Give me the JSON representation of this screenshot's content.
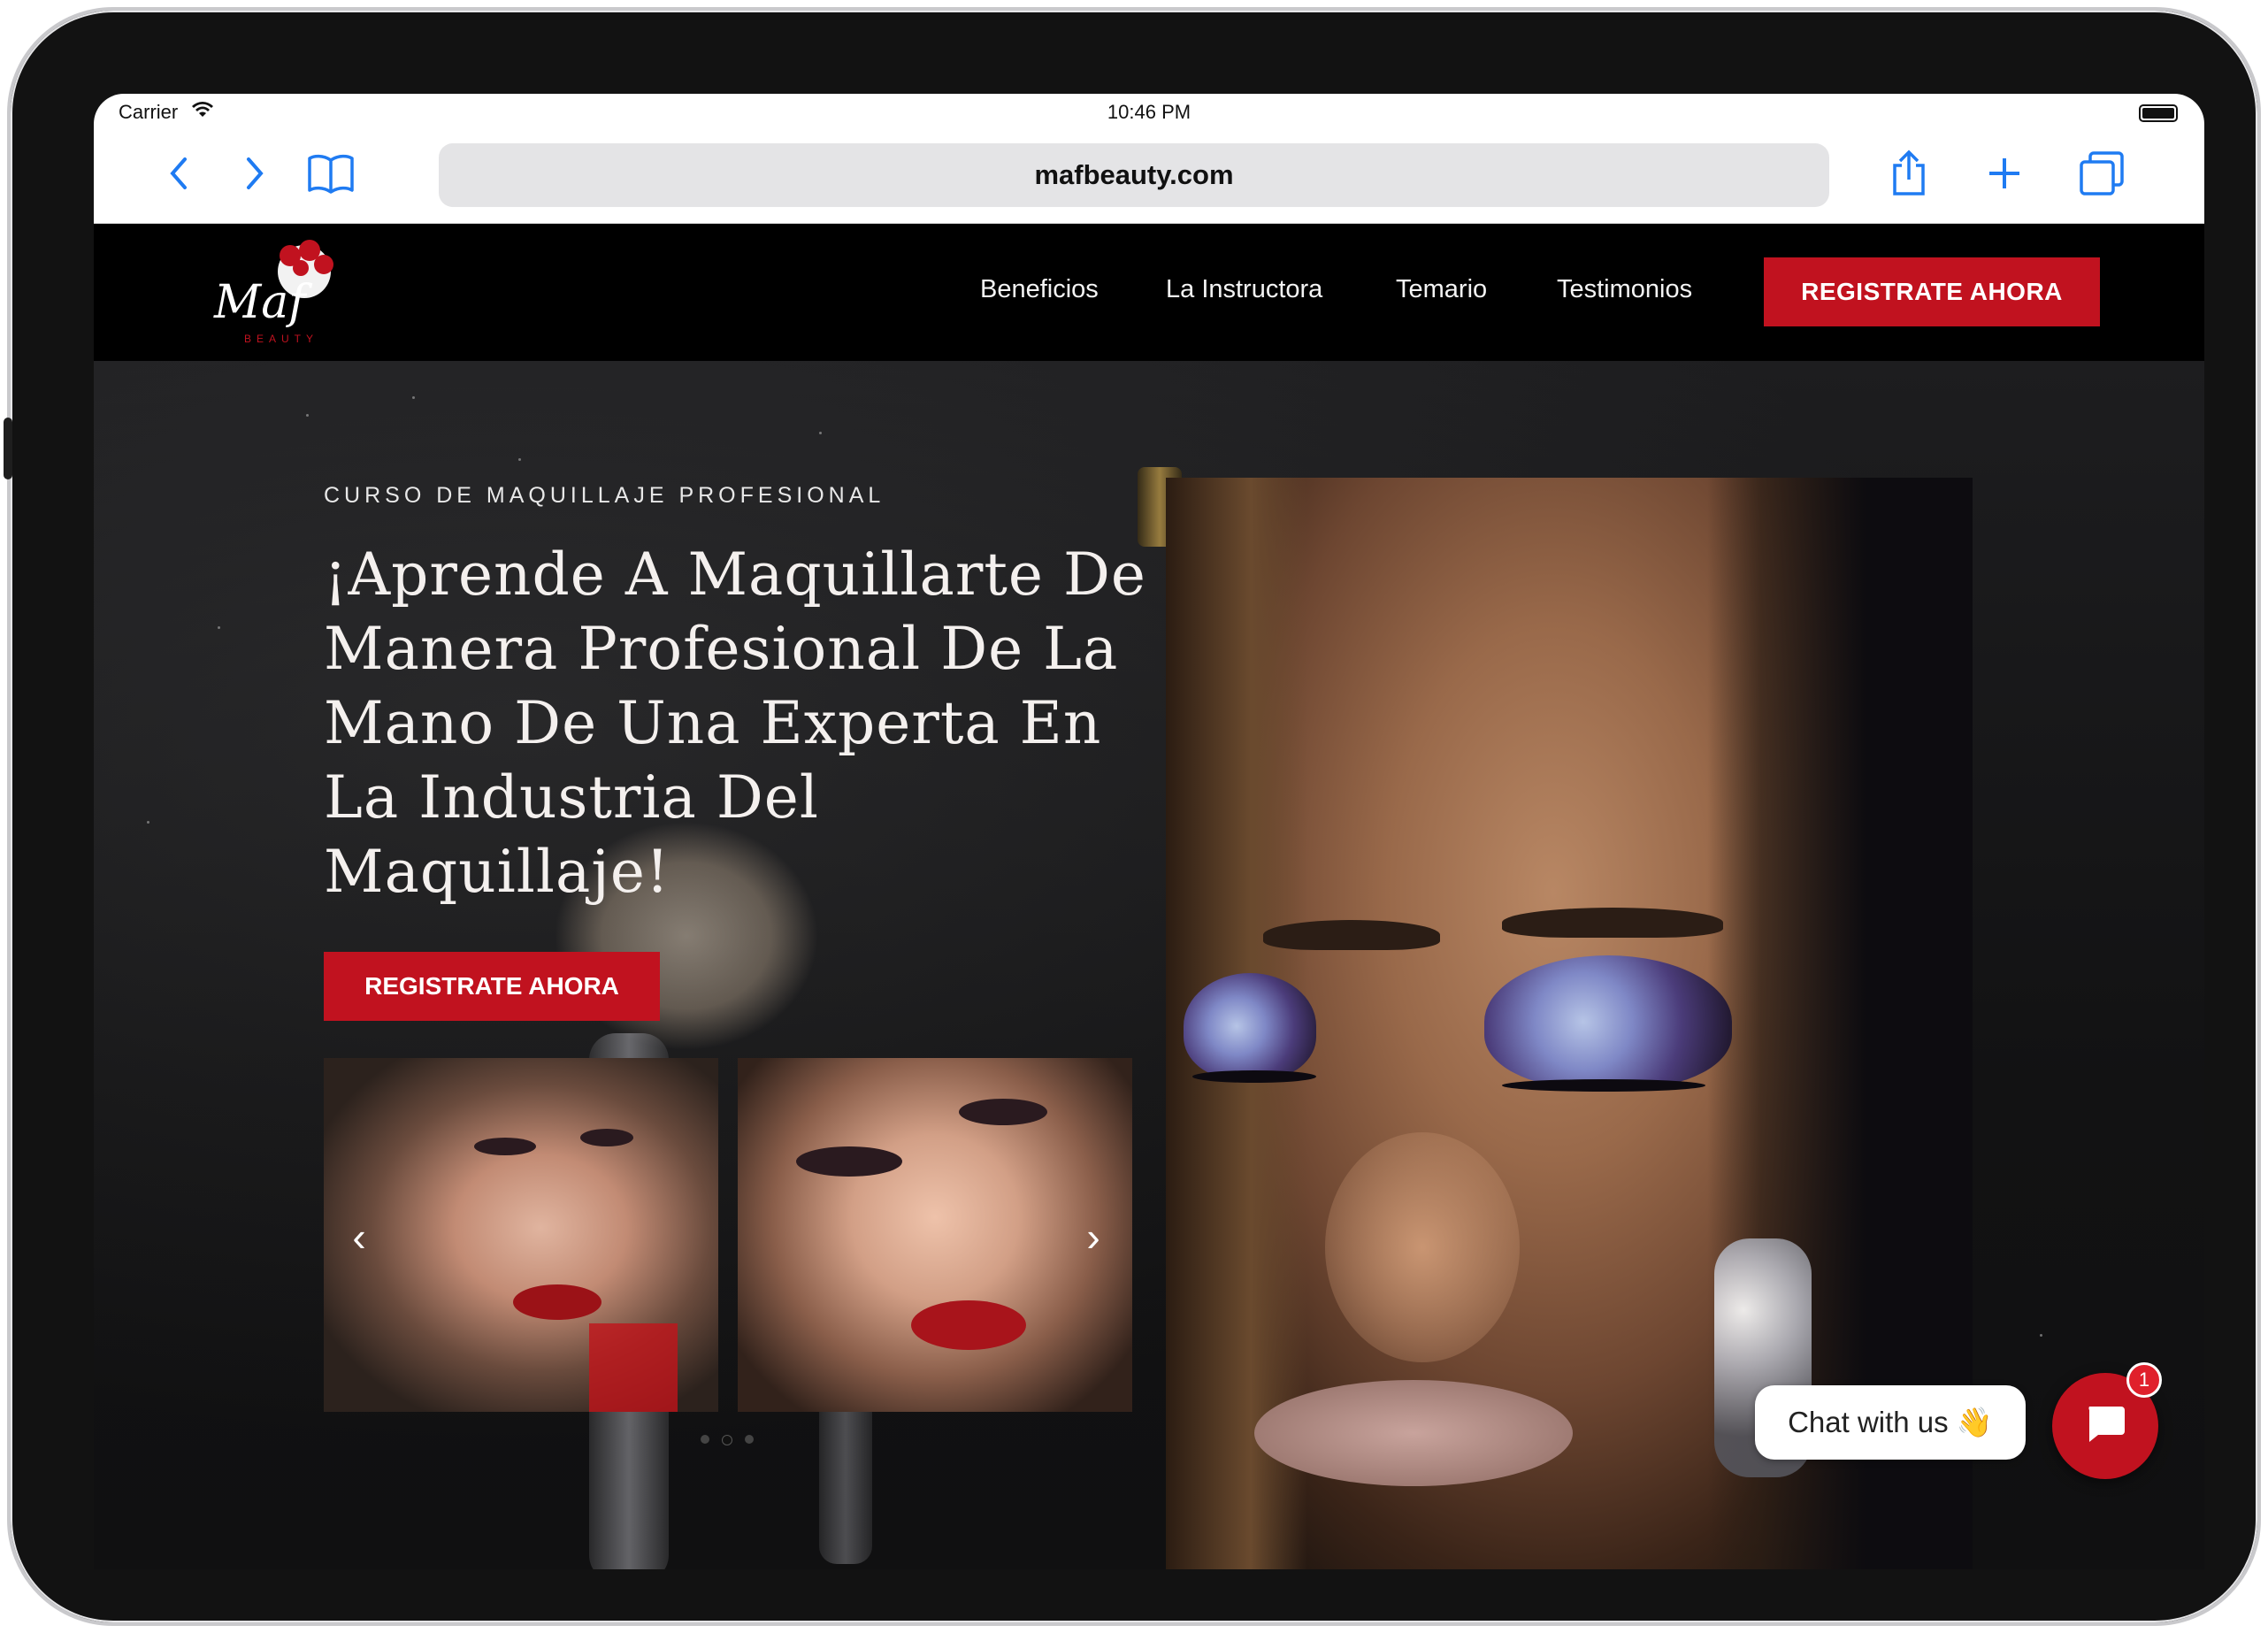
{
  "status_bar": {
    "carrier": "Carrier",
    "time": "10:46 PM"
  },
  "browser": {
    "url": "mafbeauty.com"
  },
  "nav": {
    "links": [
      "Beneficios",
      "La Instructora",
      "Temario",
      "Testimonios"
    ],
    "cta": "REGISTRATE AHORA"
  },
  "hero": {
    "eyebrow": "CURSO DE MAQUILLAJE PROFESIONAL",
    "headline": "¡Aprende A Maquillarte De Manera Profesional De La Mano De Una Experta En La Industria Del Maquillaje!",
    "cta": "REGISTRATE AHORA",
    "carousel": {
      "prev_icon": "‹",
      "next_icon": "›",
      "dot_count": 3,
      "active_dot": 1
    }
  },
  "chat": {
    "label": "Chat with us 👋",
    "badge": "1"
  },
  "colors": {
    "accent": "#c1121f",
    "link": "#1f7bf2"
  }
}
